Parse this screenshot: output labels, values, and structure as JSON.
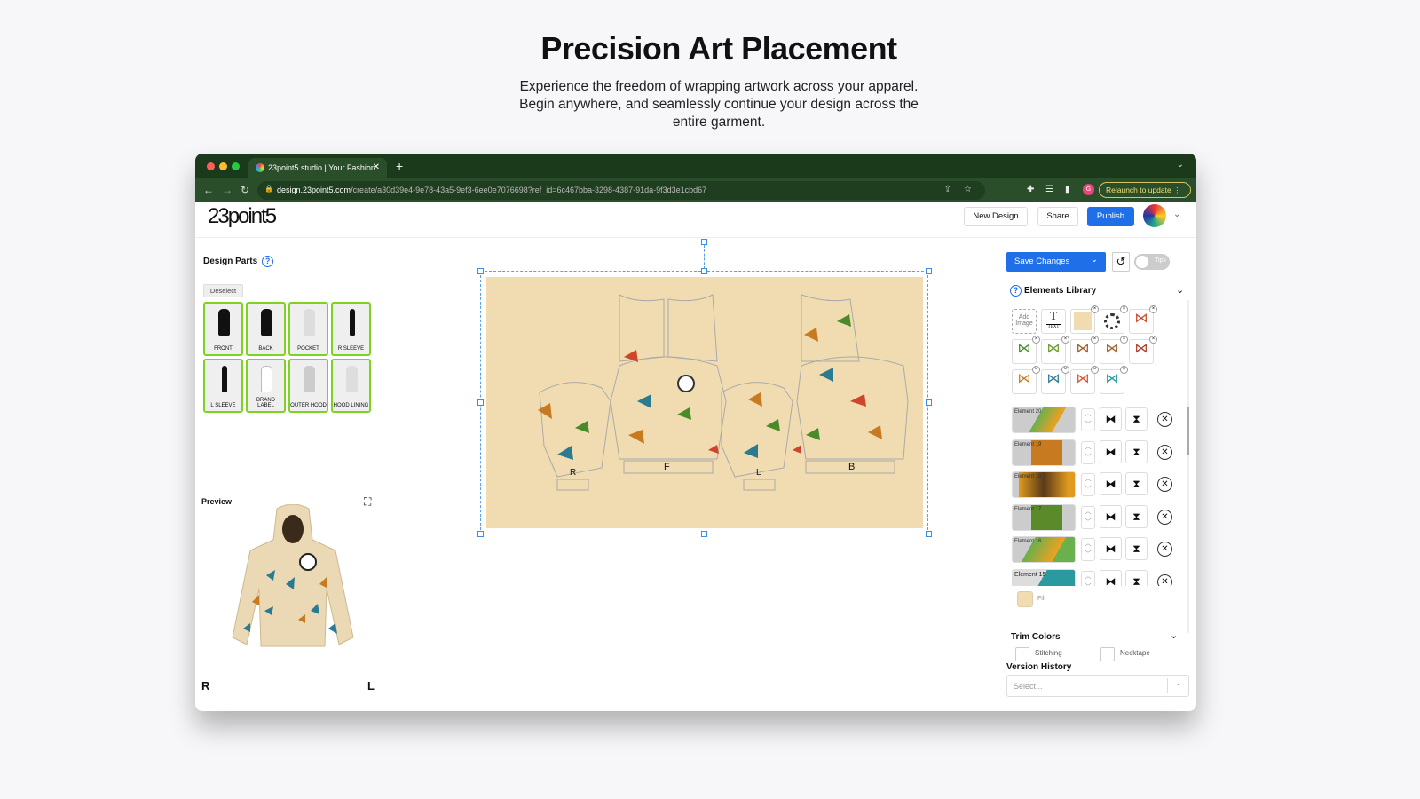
{
  "hero": {
    "title": "Precision Art Placement",
    "subtitle": "Experience the freedom of wrapping artwork across your apparel. Begin anywhere, and seamlessly continue your design across the entire garment."
  },
  "browser": {
    "tab_title": "23point5 studio | Your Fashion",
    "url_host": "design.23point5.com",
    "url_path": "/create/a30d39e4-9e78-43a5-9ef3-6ee0e7076698?ref_id=6c467bba-3298-4387-91da-9f3d3e1cbd67",
    "profile_initial": "G",
    "relaunch": "Relaunch to update"
  },
  "header": {
    "logo": "23point5",
    "new_design": "New Design",
    "share": "Share",
    "publish": "Publish"
  },
  "left": {
    "design_parts": "Design Parts",
    "deselect": "Deselect",
    "parts": [
      "FRONT",
      "BACK",
      "POCKET",
      "R SLEEVE",
      "L SLEEVE",
      "BRAND LABEL",
      "OUTER HOOD",
      "HOOD LINING"
    ],
    "preview": "Preview",
    "r": "R",
    "l": "L"
  },
  "canvas": {
    "labels": [
      "R",
      "F",
      "L",
      "B"
    ],
    "background": "#f0dcb0"
  },
  "right": {
    "save": "Save Changes",
    "tips": "Tips",
    "elements_library": "Elements Library",
    "add_image": "Add Image",
    "text_tile": "TEXT",
    "elements": [
      "Element 20",
      "Element 19",
      "Element 18",
      "Element 17",
      "Element 16",
      "Element 15"
    ],
    "fill": "Fill",
    "trim_colors": "Trim Colors",
    "stitching": "Stitching",
    "necktape": "Necktape",
    "version_history": "Version History",
    "select_placeholder": "Select..."
  },
  "colors": {
    "accent": "#1f6fe8",
    "selected_part": "#7ed321",
    "browser": "#1b3a1b"
  }
}
